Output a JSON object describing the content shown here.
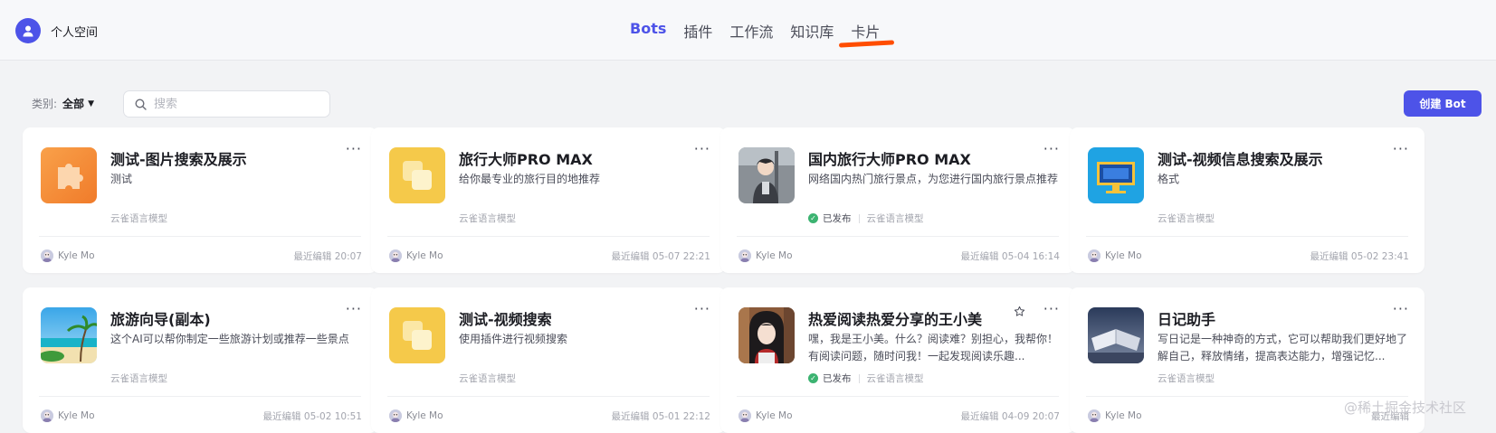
{
  "workspace": {
    "name": "个人空间",
    "icon": "user-icon"
  },
  "nav": {
    "tabs": [
      {
        "label": "Bots",
        "active": true
      },
      {
        "label": "插件",
        "active": false
      },
      {
        "label": "工作流",
        "active": false
      },
      {
        "label": "知识库",
        "active": false
      },
      {
        "label": "卡片",
        "active": false
      }
    ]
  },
  "toolbar": {
    "category_label": "类别:",
    "category_value": "全部",
    "search_placeholder": "搜索",
    "create_label": "创建 Bot"
  },
  "cards": [
    {
      "title": "测试-图片搜索及展示",
      "desc": "测试",
      "published": false,
      "status": "",
      "model": "云雀语言模型",
      "owner": "Kyle Mo",
      "edited": "最近编辑 20:07",
      "icon": "puzzle-icon",
      "starred": false
    },
    {
      "title": "旅行大师PRO MAX",
      "desc": "给你最专业的旅行目的地推荐",
      "published": false,
      "status": "",
      "model": "云雀语言模型",
      "owner": "Kyle Mo",
      "edited": "最近编辑 05-07 22:21",
      "icon": "default-bot-icon",
      "starred": false
    },
    {
      "title": "国内旅行大师PRO MAX",
      "desc": "网络国内热门旅行景点，为您进行国内旅行景点推荐",
      "published": true,
      "status": "已发布",
      "model": "云雀语言模型",
      "owner": "Kyle Mo",
      "edited": "最近编辑 05-04 16:14",
      "icon": "traveler-avatar",
      "starred": false
    },
    {
      "title": "测试-视频信息搜索及展示",
      "desc": "格式",
      "published": false,
      "status": "",
      "model": "云雀语言模型",
      "owner": "Kyle Mo",
      "edited": "最近编辑 05-02 23:41",
      "icon": "monitor-icon",
      "starred": false
    },
    {
      "title": "旅游向导(副本)",
      "desc": "这个AI可以帮你制定一些旅游计划或推荐一些景点",
      "published": false,
      "status": "",
      "model": "云雀语言模型",
      "owner": "Kyle Mo",
      "edited": "最近编辑 05-02 10:51",
      "icon": "beach-image",
      "starred": false
    },
    {
      "title": "测试-视频搜索",
      "desc": "使用插件进行视频搜索",
      "published": false,
      "status": "",
      "model": "云雀语言模型",
      "owner": "Kyle Mo",
      "edited": "最近编辑 05-01 22:12",
      "icon": "default-bot-icon",
      "starred": false
    },
    {
      "title": "热爱阅读热爱分享的王小美",
      "desc": "嘿，我是王小美。什么？阅读难？别担心，我帮你！有阅读问题，随时问我！一起发现阅读乐趣...",
      "published": true,
      "status": "已发布",
      "model": "云雀语言模型",
      "owner": "Kyle Mo",
      "edited": "最近编辑 04-09 20:07",
      "icon": "reader-avatar",
      "starred": true
    },
    {
      "title": "日记助手",
      "desc": "写日记是一种神奇的方式，它可以帮助我们更好地了解自己，释放情绪，提高表达能力，增强记忆...",
      "published": false,
      "status": "",
      "model": "云雀语言模型",
      "owner": "Kyle Mo",
      "edited": "最近编辑",
      "icon": "open-book-image",
      "starred": false
    }
  ],
  "watermark": "@稀土掘金技术社区",
  "colors": {
    "accent": "#4d53e8",
    "annotation": "#ff4d00",
    "published": "#3cb371"
  }
}
